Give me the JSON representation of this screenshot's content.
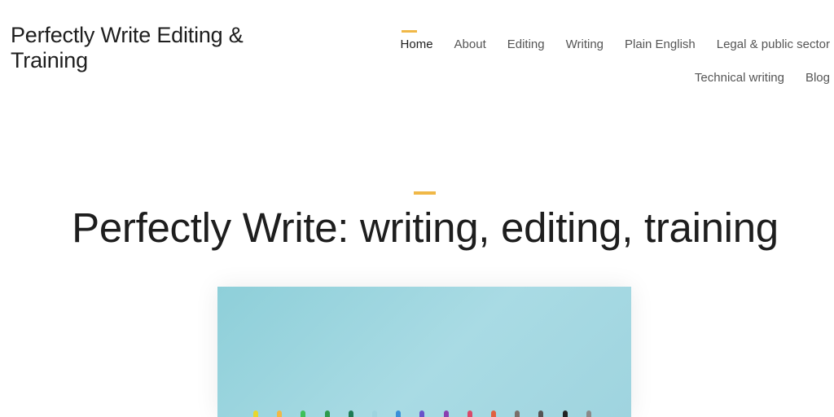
{
  "header": {
    "site_title": "Perfectly Write Editing & Training"
  },
  "nav": {
    "row1": [
      "Home",
      "About",
      "Editing",
      "Writing",
      "Plain English",
      "Legal & public sector"
    ],
    "row2": [
      "Technical writing",
      "Blog"
    ],
    "active": "Home",
    "accent_color": "#f0b847"
  },
  "hero": {
    "title": "Perfectly Write: writing, editing, training",
    "image": {
      "background_color": "#9fd4df",
      "pencil_colors": [
        "#e8d72e",
        "#f0b847",
        "#3fbf5a",
        "#2e9a4d",
        "#1f7a55",
        "#9fd4df",
        "#3a8fd8",
        "#6a52c9",
        "#8a3fb0",
        "#d84a6a",
        "#e06040",
        "#7a6f6a",
        "#555555",
        "#222222",
        "#8a8a8a"
      ]
    }
  }
}
